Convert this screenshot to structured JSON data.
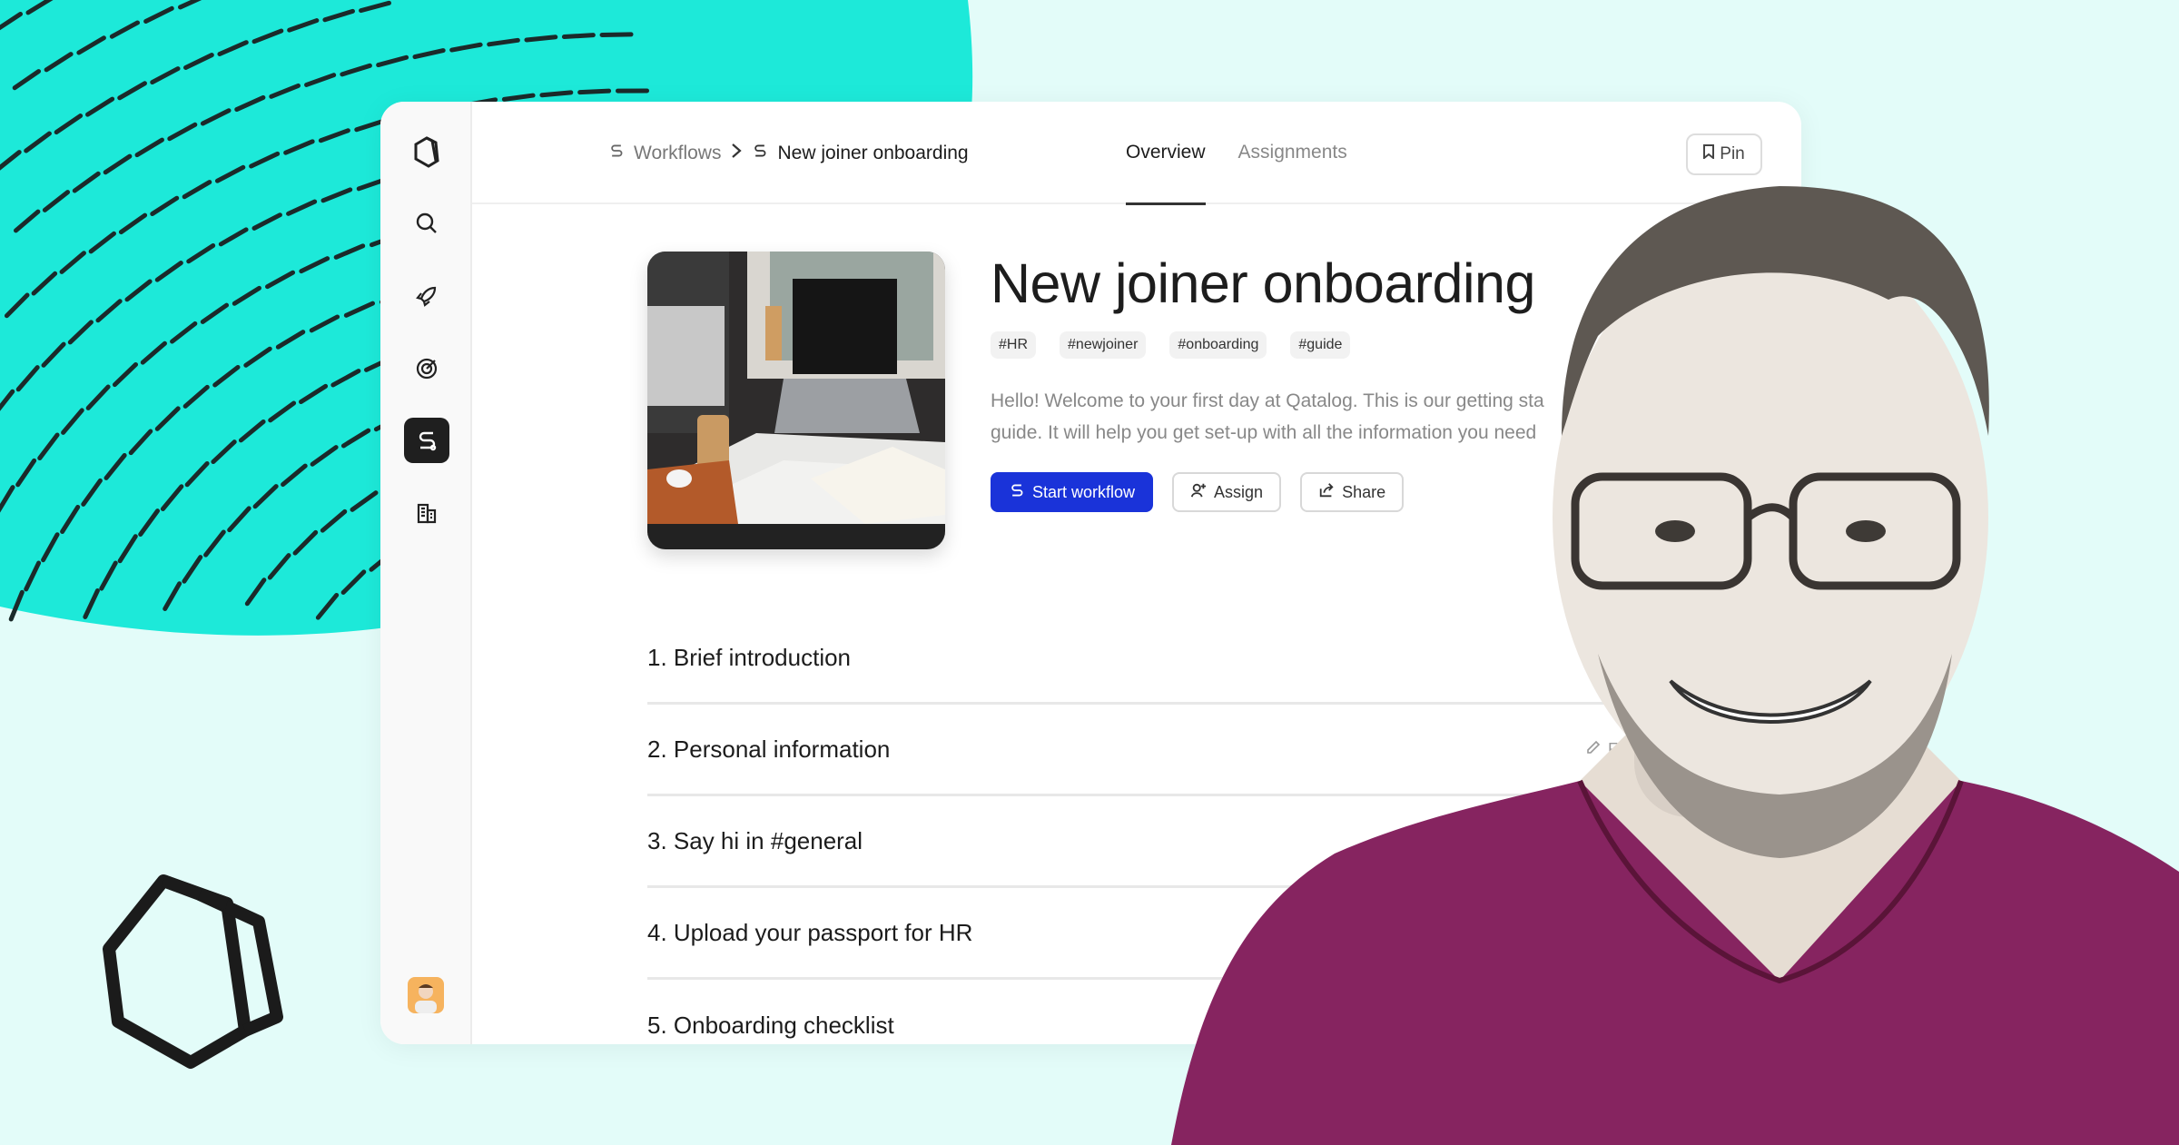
{
  "colors": {
    "accent": "#1a33d9",
    "teal": "#1de9d9",
    "background": "#e3fcf9",
    "shirt": "#862460"
  },
  "sidebar": {
    "items": [
      {
        "icon": "logo-icon"
      },
      {
        "icon": "search-icon"
      },
      {
        "icon": "rocket-icon"
      },
      {
        "icon": "target-icon"
      },
      {
        "icon": "workflow-icon",
        "active": true
      },
      {
        "icon": "building-icon"
      }
    ],
    "avatar": "user-avatar"
  },
  "breadcrumb": {
    "items": [
      "Workflows",
      "New joiner onboarding"
    ]
  },
  "tabs": [
    {
      "label": "Overview",
      "active": true
    },
    {
      "label": "Assignments"
    }
  ],
  "pin_label": "Pin",
  "workflow": {
    "title": "New joiner onboarding",
    "tags": [
      "#HR",
      "#newjoiner",
      "#onboarding",
      "#guide"
    ],
    "description_line1": "Hello! Welcome to your first day at Qatalog. This is our getting sta",
    "description_line2": "guide. It will help you get set-up with all the information you need",
    "actions": {
      "start": "Start workflow",
      "assign": "Assign",
      "share": "Share"
    }
  },
  "steps": [
    {
      "label": "1. Brief introduction",
      "type_icon": "T",
      "type_label": ""
    },
    {
      "label": "2. Personal information",
      "type_icon": "pencil-icon",
      "type_label": "Form"
    },
    {
      "label": "3. Say hi in #general",
      "type_label": ""
    },
    {
      "label": "4. Upload your passport for HR",
      "type_label": ""
    },
    {
      "label": "5. Onboarding checklist",
      "type_label": ""
    }
  ]
}
